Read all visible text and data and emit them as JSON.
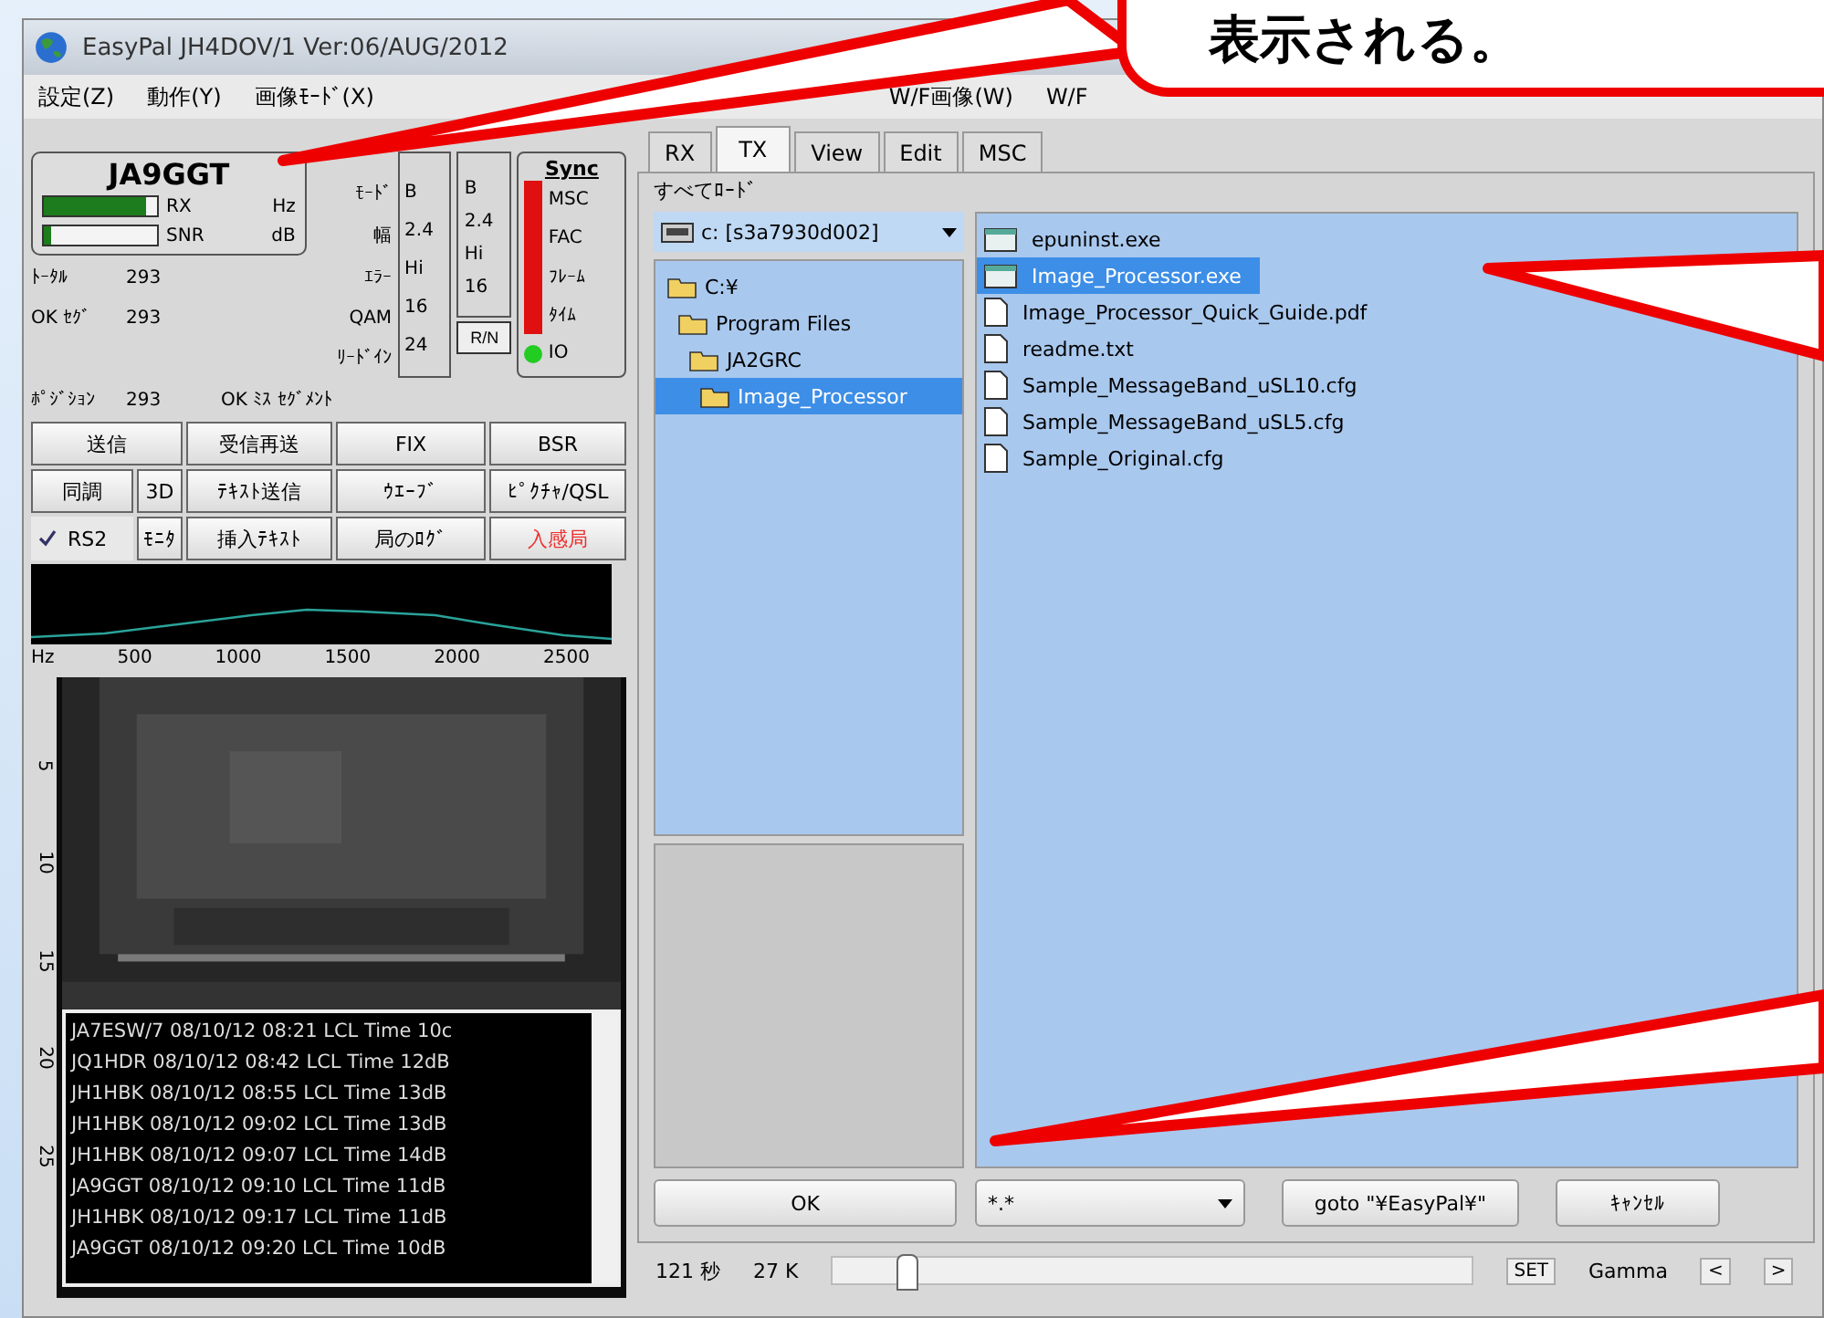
{
  "window": {
    "title": "EasyPal  JH4DOV/1  Ver:06/AUG/2012"
  },
  "menu": [
    "設定(Z)",
    "動作(Y)",
    "画像ﾓｰﾄﾞ(X)",
    "W/F画像(W)",
    "W/F"
  ],
  "status": {
    "callsign": "JA9GGT",
    "meters": [
      {
        "label": "RX",
        "unit": "Hz",
        "level": 0.9
      },
      {
        "label": "SNR",
        "unit": "dB",
        "level": 0.06
      }
    ],
    "stats": [
      {
        "label": "ﾄｰﾀﾙ",
        "value": "293"
      },
      {
        "label": "OK ｾｸﾞ",
        "value": "293"
      }
    ],
    "position": {
      "label": "ﾎﾟｼﾞｼｮﾝ",
      "value": "293",
      "note": "OK ﾐｽ ｾｸﾞﾒﾝﾄ"
    }
  },
  "params": {
    "labels": [
      "ﾓｰﾄﾞ",
      "幅",
      "ｴﾗｰ",
      "QAM",
      "ﾘｰﾄﾞｲﾝ"
    ],
    "rx": [
      "B",
      "2.4",
      "Hi",
      "16",
      "24"
    ],
    "tx": [
      "B",
      "2.4",
      "Hi",
      "16"
    ],
    "tx_button": "R/N"
  },
  "sync": {
    "title": "Sync",
    "items": [
      {
        "label": "MSC",
        "on": false
      },
      {
        "label": "FAC",
        "on": false
      },
      {
        "label": "ﾌﾚｰﾑ",
        "on": false
      },
      {
        "label": "ﾀｲﾑ",
        "on": false
      },
      {
        "label": "IO",
        "on": true
      }
    ]
  },
  "button_rows": [
    [
      {
        "kind": "button",
        "label": "送信"
      },
      {
        "kind": "button",
        "label": "受信再送"
      },
      {
        "kind": "button",
        "label": "FIX"
      },
      {
        "kind": "button",
        "label": "BSR"
      }
    ],
    [
      {
        "kind": "button",
        "label": "同調"
      },
      {
        "kind": "button",
        "label": "3D"
      },
      {
        "kind": "button",
        "label": "ﾃｷｽﾄ送信"
      },
      {
        "kind": "button",
        "label": "ｳｴｰﾌﾞ"
      },
      {
        "kind": "button",
        "label": "ﾋﾟｸﾁｬ/QSL"
      }
    ],
    [
      {
        "kind": "checkbox",
        "label": "RS2",
        "checked": true
      },
      {
        "kind": "button",
        "label": "ﾓﾆﾀ"
      },
      {
        "kind": "button",
        "label": "挿入ﾃｷｽﾄ"
      },
      {
        "kind": "button",
        "label": "局のﾛｸﾞ"
      },
      {
        "kind": "alert",
        "label": "入感局"
      }
    ]
  ],
  "spectrum_axis": [
    "Hz",
    "500",
    "1000",
    "1500",
    "2000",
    "2500"
  ],
  "waterfall_ruler": [
    "5",
    "10",
    "15",
    "20",
    "25"
  ],
  "log": [
    "JA7ESW/7  08/10/12  08:21  LCL Time  10c",
    "JQ1HDR  08/10/12  08:42  LCL Time  12dB",
    "JH1HBK  08/10/12  08:55  LCL Time  13dB",
    "JH1HBK  08/10/12  09:02  LCL Time  13dB",
    "JH1HBK  08/10/12  09:07  LCL Time  14dB",
    "JA9GGT  08/10/12  09:10  LCL Time  11dB",
    "JH1HBK  08/10/12  09:17  LCL Time  11dB",
    "JA9GGT  08/10/12  09:20  LCL Time  10dB"
  ],
  "tabs": [
    {
      "label": "RX",
      "selected": false
    },
    {
      "label": "TX",
      "selected": true
    },
    {
      "label": "View",
      "selected": false
    },
    {
      "label": "Edit",
      "selected": false
    },
    {
      "label": "MSC",
      "selected": false
    }
  ],
  "group_label": "すべてﾛｰﾄﾞ",
  "drive": "c: [s3a7930d002]",
  "folders": [
    {
      "label": "C:¥",
      "selected": false,
      "children": [
        {
          "label": "Program Files",
          "selected": false,
          "children": [
            {
              "label": "JA2GRC",
              "selected": false,
              "children": [
                {
                  "label": "Image_Processor",
                  "selected": true
                }
              ]
            }
          ]
        }
      ]
    }
  ],
  "files": [
    {
      "name": "epuninst.exe",
      "kind": "exe",
      "selected": false
    },
    {
      "name": "Image_Processor.exe",
      "kind": "exe",
      "selected": true
    },
    {
      "name": "Image_Processor_Quick_Guide.pdf",
      "kind": "doc",
      "selected": false
    },
    {
      "name": "readme.txt",
      "kind": "doc",
      "selected": false
    },
    {
      "name": "Sample_MessageBand_uSL10.cfg",
      "kind": "doc",
      "selected": false
    },
    {
      "name": "Sample_MessageBand_uSL5.cfg",
      "kind": "doc",
      "selected": false
    },
    {
      "name": "Sample_Original.cfg",
      "kind": "doc",
      "selected": false
    }
  ],
  "dialog_buttons": {
    "ok": "OK",
    "filter": "*.*",
    "goto": "goto \"¥EasyPal¥\"",
    "cancel": "ｷｬﾝｾﾙ"
  },
  "status_bar": {
    "seconds": "121 秒",
    "size": "27 K",
    "level": 0.1,
    "set": "SET",
    "gamma": "Gamma",
    "prev": "<",
    "next": ">"
  },
  "callout": {
    "text": "表示される。"
  }
}
